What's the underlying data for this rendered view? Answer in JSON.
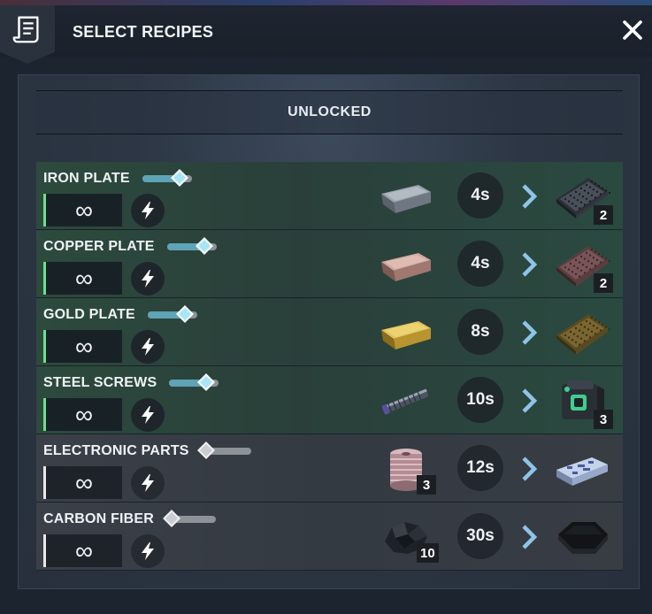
{
  "header": {
    "title": "SELECT RECIPES",
    "icon": "recipe-scroll-icon",
    "close_icon": "close-icon"
  },
  "section": {
    "title": "UNLOCKED"
  },
  "colors": {
    "unlocked_row": "#2c4a3d",
    "locked_row": "#3b4048",
    "accent_green": "#6fe08c",
    "progress_fill": "#5fa3b6"
  },
  "recipes": [
    {
      "name": "IRON PLATE",
      "progress": 0.75,
      "quantity": "∞",
      "input_icon": "iron-ingot-icon",
      "input_count": "",
      "time": "4s",
      "output_icon": "iron-plate-icon",
      "output_count": "2",
      "unlocked": true
    },
    {
      "name": "COPPER PLATE",
      "progress": 0.75,
      "quantity": "∞",
      "input_icon": "copper-ingot-icon",
      "input_count": "",
      "time": "4s",
      "output_icon": "copper-plate-icon",
      "output_count": "2",
      "unlocked": true
    },
    {
      "name": "GOLD PLATE",
      "progress": 0.75,
      "quantity": "∞",
      "input_icon": "gold-ingot-icon",
      "input_count": "",
      "time": "8s",
      "output_icon": "gold-plate-icon",
      "output_count": "",
      "unlocked": true
    },
    {
      "name": "STEEL SCREWS",
      "progress": 0.75,
      "quantity": "∞",
      "input_icon": "steel-rod-icon",
      "input_count": "",
      "time": "10s",
      "output_icon": "steel-screws-icon",
      "output_count": "3",
      "unlocked": true
    },
    {
      "name": "ELECTRONIC PARTS",
      "progress": 0.1,
      "quantity": "∞",
      "input_icon": "wire-spool-icon",
      "input_count": "3",
      "time": "12s",
      "output_icon": "electronic-parts-icon",
      "output_count": "",
      "unlocked": false
    },
    {
      "name": "CARBON FIBER",
      "progress": 0.1,
      "quantity": "∞",
      "input_icon": "carbon-lump-icon",
      "input_count": "10",
      "time": "30s",
      "output_icon": "carbon-fiber-icon",
      "output_count": "",
      "unlocked": false
    }
  ]
}
